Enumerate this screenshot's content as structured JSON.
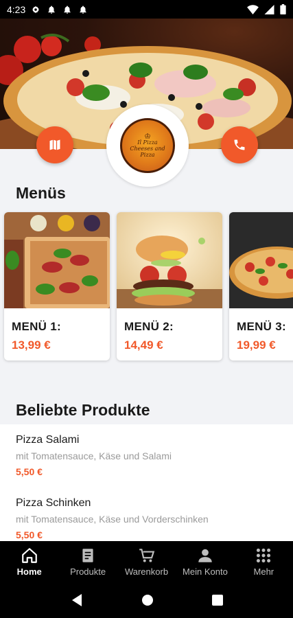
{
  "status_bar": {
    "time": "4:23",
    "left_icons": [
      "gear-icon",
      "bell-icon",
      "bell-icon",
      "bell-icon"
    ],
    "right_icons": [
      "wifi-icon",
      "signal-icon",
      "battery-icon"
    ]
  },
  "hero": {
    "map_button": "map-icon",
    "phone_button": "phone-icon",
    "logo_text": "Il Pizza Cheeses and Pizza"
  },
  "menus": {
    "title": "Menüs",
    "items": [
      {
        "title": "MENÜ 1:",
        "price": "13,99 €"
      },
      {
        "title": "MENÜ 2:",
        "price": "14,49 €"
      },
      {
        "title": "MENÜ 3:",
        "price": "19,99 €"
      }
    ]
  },
  "popular": {
    "title": "Beliebte Produkte",
    "items": [
      {
        "name": "Pizza Salami",
        "description": "mit Tomatensauce, Käse und Salami",
        "price": "5,50 €"
      },
      {
        "name": "Pizza Schinken",
        "description": "mit Tomatensauce, Käse und Vorderschinken",
        "price": "5,50 €"
      }
    ]
  },
  "bottom_nav": {
    "items": [
      {
        "label": "Home",
        "icon": "home-icon",
        "active": true
      },
      {
        "label": "Produkte",
        "icon": "receipt-icon",
        "active": false
      },
      {
        "label": "Warenkorb",
        "icon": "cart-icon",
        "active": false
      },
      {
        "label": "Mein Konto",
        "icon": "person-icon",
        "active": false
      },
      {
        "label": "Mehr",
        "icon": "grid-icon",
        "active": false
      }
    ]
  },
  "colors": {
    "accent": "#f1592a",
    "background": "#f2f3f6",
    "nav_background": "#000000"
  }
}
